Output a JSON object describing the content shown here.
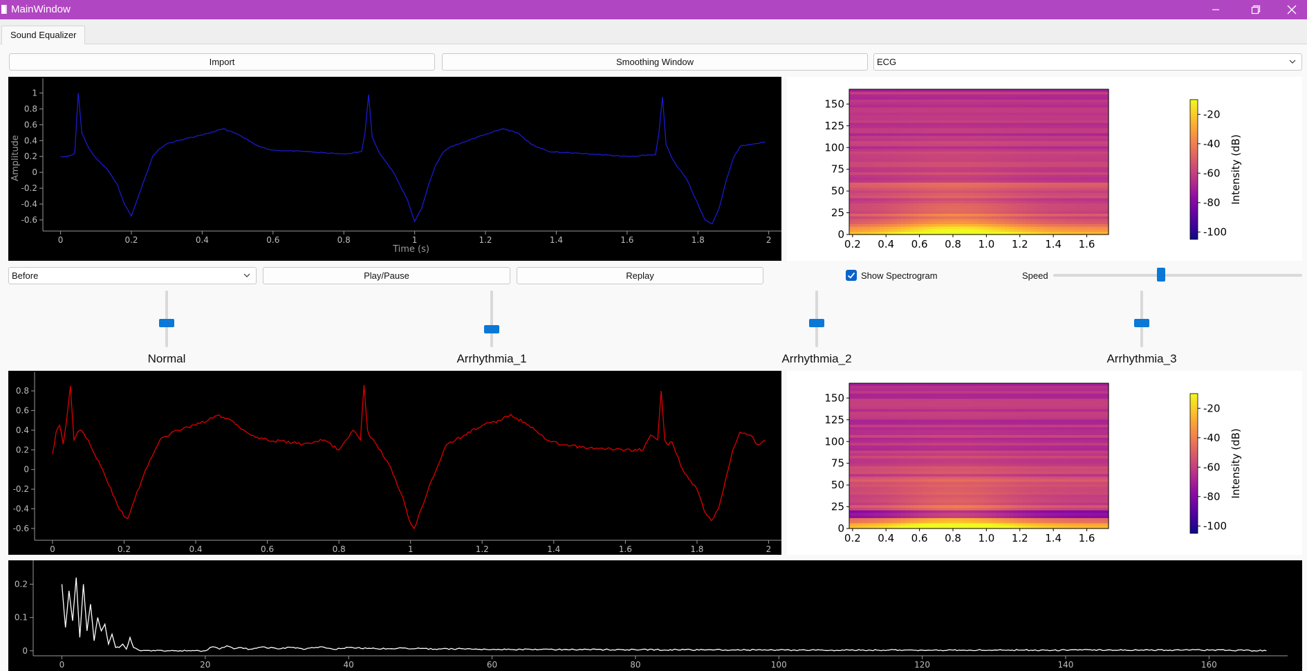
{
  "window": {
    "title": "MainWindow"
  },
  "tabs": [
    {
      "label": "Sound Equalizer"
    }
  ],
  "toolbar": {
    "import_label": "Import",
    "smoothing_label": "Smoothing Window",
    "signal_type": "ECG"
  },
  "controls": {
    "view_select": "Before",
    "play_pause_label": "Play/Pause",
    "replay_label": "Replay",
    "show_spectrogram_label": "Show Spectrogram",
    "show_spectrogram_checked": true,
    "speed_label": "Speed",
    "speed_value": 0.43
  },
  "bands": [
    {
      "label": "Normal",
      "value": 0.42
    },
    {
      "label": "Arrhythmia_1",
      "value": 0.28
    },
    {
      "label": "Arrhythmia_2",
      "value": 0.42
    },
    {
      "label": "Arrhythmia_3",
      "value": 0.42
    }
  ],
  "colors": {
    "titlebar": "#b146c2",
    "accent": "#0a78d7",
    "input_signal": "#1a1ad0",
    "output_signal": "#e00000",
    "fft_signal": "#ffffff"
  },
  "chart_data": [
    {
      "id": "input-signal",
      "type": "line",
      "xlabel": "Time (s)",
      "ylabel": "Amplitude",
      "xlim": [
        -0.05,
        2.03
      ],
      "ylim": [
        -0.74,
        1.1
      ],
      "xticks": [
        "0",
        "0.2",
        "0.4",
        "0.6",
        "0.8",
        "1",
        "1.2",
        "1.4",
        "1.6",
        "1.8",
        "2"
      ],
      "yticks": [
        "1",
        "0.8",
        "0.6",
        "0.4",
        "0.2",
        "0",
        "-0.2",
        "-0.4",
        "-0.6"
      ],
      "series": [
        {
          "x": [
            0.0,
            0.02,
            0.04,
            0.05,
            0.06,
            0.08,
            0.1,
            0.13,
            0.16,
            0.18,
            0.2,
            0.22,
            0.24,
            0.26,
            0.28,
            0.3,
            0.35,
            0.4,
            0.46,
            0.5,
            0.55,
            0.58,
            0.6,
            0.7,
            0.8,
            0.85,
            0.86,
            0.87,
            0.88,
            0.9,
            0.94,
            0.98,
            1.0,
            1.02,
            1.04,
            1.06,
            1.08,
            1.1,
            1.15,
            1.2,
            1.25,
            1.29,
            1.33,
            1.38,
            1.42,
            1.5,
            1.6,
            1.68,
            1.69,
            1.7,
            1.71,
            1.73,
            1.77,
            1.8,
            1.82,
            1.84,
            1.86,
            1.88,
            1.9,
            1.92,
            1.96,
            1.99
          ],
          "y": [
            0.2,
            0.2,
            0.24,
            1.0,
            0.5,
            0.3,
            0.18,
            0.05,
            -0.15,
            -0.4,
            -0.55,
            -0.3,
            -0.05,
            0.2,
            0.3,
            0.36,
            0.42,
            0.47,
            0.55,
            0.48,
            0.35,
            0.3,
            0.28,
            0.26,
            0.23,
            0.26,
            0.5,
            0.98,
            0.45,
            0.25,
            0.0,
            -0.35,
            -0.62,
            -0.45,
            -0.15,
            0.1,
            0.25,
            0.32,
            0.4,
            0.48,
            0.55,
            0.5,
            0.35,
            0.26,
            0.25,
            0.23,
            0.2,
            0.22,
            0.5,
            0.95,
            0.35,
            0.15,
            -0.1,
            -0.4,
            -0.6,
            -0.65,
            -0.45,
            -0.1,
            0.18,
            0.33,
            0.36,
            0.38
          ]
        }
      ]
    },
    {
      "id": "output-signal",
      "type": "line",
      "xlim": [
        -0.05,
        2.03
      ],
      "ylim": [
        -0.72,
        0.92
      ],
      "xticks": [
        "0",
        "0.2",
        "0.4",
        "0.6",
        "0.8",
        "1",
        "1.2",
        "1.4",
        "1.6",
        "1.8",
        "2"
      ],
      "yticks": [
        "0.8",
        "0.6",
        "0.4",
        "0.2",
        "0",
        "-0.2",
        "-0.4",
        "-0.6"
      ],
      "series": [
        {
          "x": [
            0.0,
            0.01,
            0.02,
            0.03,
            0.04,
            0.05,
            0.06,
            0.07,
            0.08,
            0.1,
            0.14,
            0.18,
            0.2,
            0.21,
            0.23,
            0.26,
            0.3,
            0.35,
            0.4,
            0.46,
            0.5,
            0.55,
            0.6,
            0.7,
            0.76,
            0.8,
            0.82,
            0.84,
            0.86,
            0.87,
            0.88,
            0.89,
            0.9,
            0.94,
            0.98,
            1.0,
            1.01,
            1.03,
            1.06,
            1.1,
            1.15,
            1.2,
            1.25,
            1.28,
            1.33,
            1.38,
            1.42,
            1.5,
            1.6,
            1.65,
            1.67,
            1.69,
            1.7,
            1.71,
            1.72,
            1.73,
            1.76,
            1.8,
            1.82,
            1.84,
            1.86,
            1.88,
            1.9,
            1.92,
            1.95,
            1.97,
            1.99
          ],
          "y": [
            0.16,
            0.38,
            0.45,
            0.26,
            0.52,
            0.85,
            0.3,
            0.38,
            0.4,
            0.3,
            0.0,
            -0.35,
            -0.48,
            -0.5,
            -0.3,
            0.0,
            0.3,
            0.4,
            0.45,
            0.55,
            0.5,
            0.36,
            0.3,
            0.26,
            0.3,
            0.2,
            0.3,
            0.4,
            0.3,
            0.86,
            0.4,
            0.32,
            0.28,
            0.05,
            -0.3,
            -0.55,
            -0.6,
            -0.4,
            -0.1,
            0.25,
            0.35,
            0.45,
            0.5,
            0.56,
            0.45,
            0.3,
            0.25,
            0.22,
            0.2,
            0.2,
            0.35,
            0.3,
            0.8,
            0.3,
            0.25,
            0.28,
            0.0,
            -0.2,
            -0.42,
            -0.52,
            -0.4,
            -0.1,
            0.2,
            0.38,
            0.35,
            0.25,
            0.3
          ]
        }
      ]
    },
    {
      "id": "input-spectrogram",
      "type": "heatmap",
      "xticks": [
        "0.2",
        "0.4",
        "0.6",
        "0.8",
        "1.0",
        "1.2",
        "1.4",
        "1.6"
      ],
      "yticks": [
        "150",
        "125",
        "100",
        "75",
        "50",
        "25",
        "0"
      ],
      "colorbar_label": "Intensity (dB)",
      "colorbar_ticks": [
        "-20",
        "-40",
        "-60",
        "-80",
        "-100"
      ],
      "xlim": [
        0.18,
        1.73
      ],
      "ylim": [
        0,
        167
      ]
    },
    {
      "id": "output-spectrogram",
      "type": "heatmap",
      "xticks": [
        "0.2",
        "0.4",
        "0.6",
        "0.8",
        "1.0",
        "1.2",
        "1.4",
        "1.6"
      ],
      "yticks": [
        "150",
        "125",
        "100",
        "75",
        "50",
        "25",
        "0"
      ],
      "colorbar_label": "Intensity (dB)",
      "colorbar_ticks": [
        "-20",
        "-40",
        "-60",
        "-80",
        "-100"
      ],
      "xlim": [
        0.18,
        1.73
      ],
      "ylim": [
        0,
        167
      ]
    },
    {
      "id": "fft",
      "type": "line",
      "xlim": [
        -4,
        170
      ],
      "ylim": [
        -0.015,
        0.255
      ],
      "xticks": [
        "0",
        "20",
        "40",
        "60",
        "80",
        "100",
        "120",
        "140",
        "160"
      ],
      "yticks": [
        "0.2",
        "0.1",
        "0"
      ],
      "series": [
        {
          "x": [
            0,
            0.5,
            1,
            1.5,
            2,
            2.5,
            3,
            3.5,
            4,
            4.5,
            5,
            5.5,
            6,
            6.5,
            7,
            7.5,
            8,
            8.5,
            9,
            9.5,
            10,
            11,
            20,
            21,
            22,
            23,
            24,
            25,
            26,
            28,
            30,
            32,
            34,
            36,
            38,
            40,
            44,
            48,
            52,
            56,
            60,
            70,
            80,
            90,
            100,
            110,
            120,
            130,
            140,
            150,
            160,
            168
          ],
          "y": [
            0.2,
            0.07,
            0.18,
            0.09,
            0.22,
            0.04,
            0.2,
            0.06,
            0.14,
            0.03,
            0.1,
            0.06,
            0.08,
            0.02,
            0.05,
            0.01,
            0.01,
            0.02,
            0.005,
            0.04,
            0.01,
            0.0,
            0.0,
            0.012,
            0.005,
            0.015,
            0.006,
            0.01,
            0.004,
            0.012,
            0.006,
            0.01,
            0.005,
            0.012,
            0.004,
            0.01,
            0.006,
            0.008,
            0.005,
            0.006,
            0.004,
            0.004,
            0.003,
            0.003,
            0.002,
            0.002,
            0.002,
            0.002,
            0.002,
            0.002,
            0.002,
            0.0
          ]
        }
      ]
    }
  ]
}
